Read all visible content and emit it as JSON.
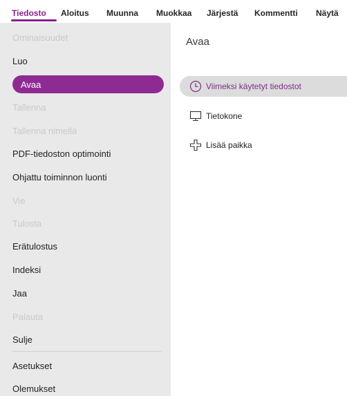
{
  "ribbon": {
    "tabs": [
      {
        "label": "Tiedosto",
        "active": true
      },
      {
        "label": "Aloitus"
      },
      {
        "label": "Muunna"
      },
      {
        "label": "Muokkaa"
      },
      {
        "label": "Järjestä"
      },
      {
        "label": "Kommentti"
      },
      {
        "label": "Näytä"
      }
    ]
  },
  "nav": {
    "items": [
      {
        "label": "Ominaisuudet",
        "disabled": true
      },
      {
        "label": "Luo"
      },
      {
        "label": "Avaa",
        "selected": true
      },
      {
        "label": "Tallenna",
        "disabled": true
      },
      {
        "label": "Tallenna nimellä",
        "disabled": true
      },
      {
        "label": "PDF-tiedoston optimointi"
      },
      {
        "label": "Ohjattu toiminnon luonti"
      },
      {
        "label": "Vie",
        "disabled": true
      },
      {
        "label": "Tulosta",
        "disabled": true
      },
      {
        "label": "Erätulostus"
      },
      {
        "label": "Indeksi"
      },
      {
        "label": "Jaa"
      },
      {
        "label": "Palauta",
        "disabled": true
      },
      {
        "label": "Sulje"
      },
      {
        "label": "Asetukset"
      },
      {
        "label": "Olemukset"
      }
    ]
  },
  "main": {
    "title": "Avaa",
    "places": [
      {
        "label": "Viimeksi käytetyt tiedostot",
        "icon": "clock-icon",
        "selected": true
      },
      {
        "label": "Tietokone",
        "icon": "computer-icon"
      },
      {
        "label": "Lisää paikka",
        "icon": "add-place-icon"
      }
    ]
  },
  "colors": {
    "accent": "#8e2b93",
    "nav_background": "#e9e9e9",
    "selected_place_background": "#dcdcdc"
  }
}
